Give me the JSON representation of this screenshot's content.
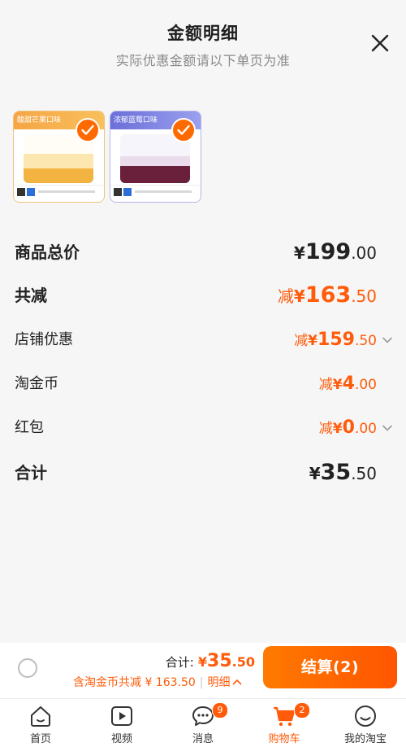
{
  "header": {
    "title": "金额明细",
    "subtitle": "实际优惠金额请以下单页为准"
  },
  "products": [
    {
      "band_text": "酸甜芒果口味",
      "selected": true
    },
    {
      "band_text": "浓郁蓝莓口味",
      "selected": true
    }
  ],
  "rows": {
    "total_price": {
      "label": "商品总价",
      "prefix": "",
      "yen": "¥",
      "int": "199",
      "dec": ".00"
    },
    "total_discount": {
      "label": "共减",
      "prefix": "减",
      "yen": "¥",
      "int": "163",
      "dec": ".50"
    },
    "shop_discount": {
      "label": "店铺优惠",
      "prefix": "减",
      "yen": "¥",
      "int": "159",
      "dec": ".50"
    },
    "taojinbi": {
      "label": "淘金币",
      "prefix": "减",
      "yen": "¥",
      "int": "4",
      "dec": ".00"
    },
    "red_packet": {
      "label": "红包",
      "prefix": "减",
      "yen": "¥",
      "int": "0",
      "dec": ".00"
    },
    "subtotal": {
      "label": "合计",
      "prefix": "",
      "yen": "¥",
      "int": "35",
      "dec": ".50"
    }
  },
  "bottom": {
    "total_label": "合计:",
    "total_yen": "¥",
    "total_int": "35",
    "total_dec": ".50",
    "saving_text": "含淘金币共减 ¥ 163.50",
    "detail_label": "明细",
    "checkout_label": "结算(2)"
  },
  "tabs": [
    {
      "label": "首页",
      "icon": "home-icon",
      "badge": ""
    },
    {
      "label": "视频",
      "icon": "video-icon",
      "badge": ""
    },
    {
      "label": "消息",
      "icon": "message-icon",
      "badge": "9"
    },
    {
      "label": "购物车",
      "icon": "cart-icon",
      "badge": "2",
      "active": true
    },
    {
      "label": "我的淘宝",
      "icon": "profile-icon",
      "badge": ""
    }
  ],
  "colors": {
    "accent": "#ff5b0a",
    "background": "#f6f6f6"
  }
}
